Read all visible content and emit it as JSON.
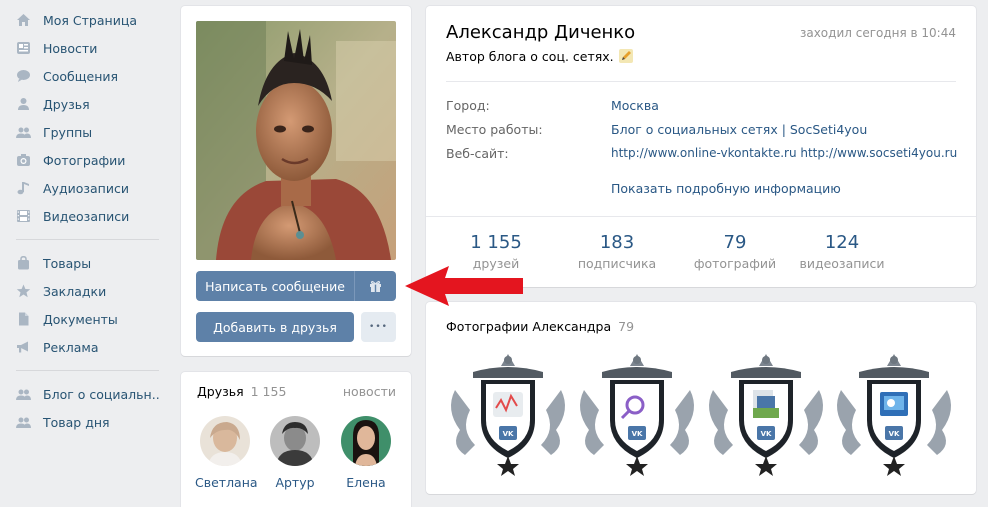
{
  "sidebar": {
    "items": [
      {
        "label": "Моя Страница",
        "icon": "home-icon"
      },
      {
        "label": "Новости",
        "icon": "news-icon"
      },
      {
        "label": "Сообщения",
        "icon": "messages-icon"
      },
      {
        "label": "Друзья",
        "icon": "friends-icon"
      },
      {
        "label": "Группы",
        "icon": "groups-icon"
      },
      {
        "label": "Фотографии",
        "icon": "camera-icon"
      },
      {
        "label": "Аудиозаписи",
        "icon": "music-icon"
      },
      {
        "label": "Видеозаписи",
        "icon": "video-icon"
      },
      {
        "label": "Товары",
        "icon": "bag-icon"
      },
      {
        "label": "Закладки",
        "icon": "star-icon"
      },
      {
        "label": "Документы",
        "icon": "document-icon"
      },
      {
        "label": "Реклама",
        "icon": "megaphone-icon"
      },
      {
        "label": "Блог о социальн..",
        "icon": "group-icon"
      },
      {
        "label": "Товар дня",
        "icon": "group-icon"
      }
    ]
  },
  "profile": {
    "name": "Александр Диченко",
    "status": "Автор блога о соц. сетях.",
    "last_seen": "заходил сегодня в 10:44",
    "info": {
      "city_label": "Город:",
      "city_value": "Москва",
      "work_label": "Место работы:",
      "work_value": "Блог о социальных сетях | SocSeti4you",
      "site_label": "Веб-сайт:",
      "site_value": "http://www.online-vkontakte.ru http://www.socseti4you.ru",
      "more_link": "Показать подробную информацию"
    },
    "counters": [
      {
        "value": "1 155",
        "label": "друзей"
      },
      {
        "value": "183",
        "label": "подписчика"
      },
      {
        "value": "79",
        "label": "фотографий"
      },
      {
        "value": "124",
        "label": "видеозаписи"
      }
    ]
  },
  "actions": {
    "write_message": "Написать сообщение",
    "add_friend": "Добавить в друзья",
    "more": "•••"
  },
  "friends_block": {
    "title": "Друзья",
    "count": "1 155",
    "news_link": "новости",
    "friends": [
      {
        "name": "Светлана"
      },
      {
        "name": "Артур"
      },
      {
        "name": "Елена"
      }
    ]
  },
  "photos_block": {
    "title": "Фотографии Александра",
    "count": "79"
  },
  "colors": {
    "accent": "#5e81a8",
    "link": "#2a5885",
    "background": "#edeef0",
    "arrow": "#e4151f"
  }
}
